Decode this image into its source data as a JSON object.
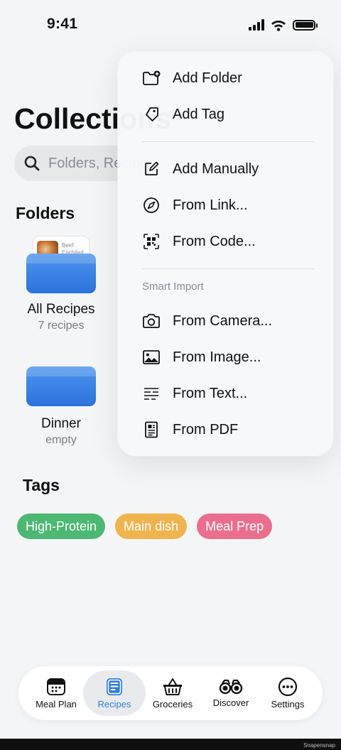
{
  "status": {
    "time": "9:41"
  },
  "page": {
    "title": "Collections"
  },
  "search": {
    "placeholder": "Folders, Recipes"
  },
  "folders_section": {
    "title": "Folders"
  },
  "folders": [
    {
      "name": "All Recipes",
      "count": "7 recipes",
      "preview_text": "Beef Enchilad..."
    },
    {
      "name": "Dinner",
      "count": "empty"
    }
  ],
  "tags_section": {
    "title": "Tags"
  },
  "tags": [
    {
      "label": "High-Protein",
      "color": "#4cb873"
    },
    {
      "label": "Main dish",
      "color": "#f0b44e"
    },
    {
      "label": "Meal Prep",
      "color": "#ea6f8e"
    }
  ],
  "menu": {
    "items_top": [
      {
        "label": "Add Folder",
        "icon": "folder-plus-icon"
      },
      {
        "label": "Add Tag",
        "icon": "tag-icon"
      }
    ],
    "items_middle": [
      {
        "label": "Add Manually",
        "icon": "edit-square-icon"
      },
      {
        "label": "From Link...",
        "icon": "compass-icon"
      },
      {
        "label": "From Code...",
        "icon": "qr-code-icon"
      }
    ],
    "smart_import_title": "Smart Import",
    "items_smart": [
      {
        "label": "From Camera...",
        "icon": "camera-icon"
      },
      {
        "label": "From Image...",
        "icon": "photo-icon"
      },
      {
        "label": "From Text...",
        "icon": "text-lines-icon"
      },
      {
        "label": "From PDF",
        "icon": "pdf-document-icon"
      }
    ]
  },
  "tab_bar": {
    "tabs": [
      {
        "label": "Meal Plan",
        "icon": "calendar-icon"
      },
      {
        "label": "Recipes",
        "icon": "recipe-book-icon",
        "active": true
      },
      {
        "label": "Groceries",
        "icon": "basket-icon"
      },
      {
        "label": "Discover",
        "icon": "binoculars-icon"
      },
      {
        "label": "Settings",
        "icon": "more-circle-icon"
      }
    ],
    "active_color": "#2f7fd8"
  },
  "watermark": "Snapensnap"
}
